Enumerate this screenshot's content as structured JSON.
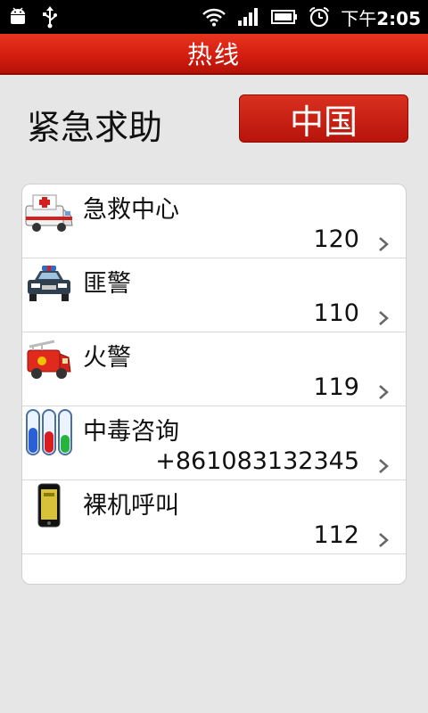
{
  "status_bar": {
    "time_prefix": "下午",
    "time": "2:05",
    "icons": [
      "android-icon",
      "usb-icon",
      "wifi-icon",
      "signal-icon",
      "battery-icon",
      "alarm-icon"
    ]
  },
  "header": {
    "title": "热线"
  },
  "emergency": {
    "label": "紧急求助",
    "country_button": "中国"
  },
  "hotlines": [
    {
      "name": "急救中心",
      "number": "120",
      "icon": "ambulance-icon"
    },
    {
      "name": "匪警",
      "number": "110",
      "icon": "police-car-icon"
    },
    {
      "name": "火警",
      "number": "119",
      "icon": "fire-truck-icon"
    },
    {
      "name": "中毒咨询",
      "number": "+861083132345",
      "icon": "test-tubes-icon"
    },
    {
      "name": "裸机呼叫",
      "number": "112",
      "icon": "mobile-phone-icon"
    }
  ],
  "colors": {
    "accent": "#d31d10",
    "background": "#e6e6e6"
  }
}
